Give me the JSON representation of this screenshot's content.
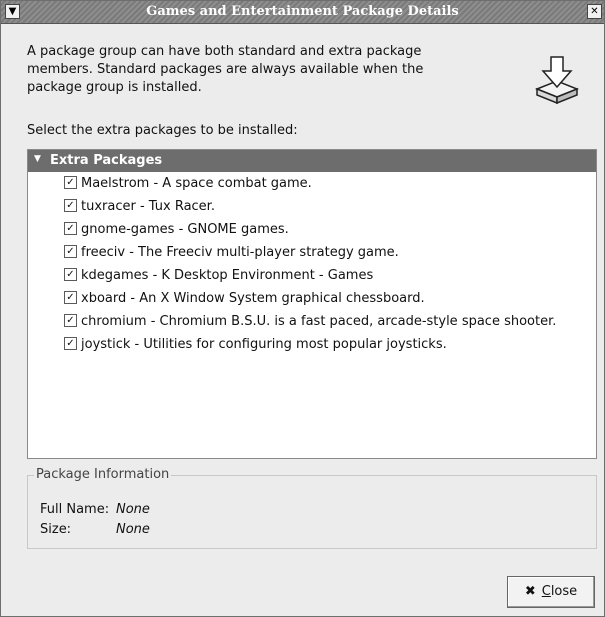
{
  "window": {
    "title": "Games and Entertainment Package Details",
    "menu_icon": "chevron-down-icon",
    "close_icon": "close-icon"
  },
  "description": "A package group can have both standard and extra package members.  Standard packages are always available when the package group is installed.",
  "install_icon": "install-arrow-icon",
  "select_label": "Select the extra packages to be installed:",
  "group": {
    "label": "Extra Packages",
    "expanded": true,
    "items": [
      {
        "label": "Maelstrom - A space combat game.",
        "checked": true
      },
      {
        "label": "tuxracer - Tux Racer.",
        "checked": true
      },
      {
        "label": "gnome-games - GNOME games.",
        "checked": true
      },
      {
        "label": "freeciv - The Freeciv multi-player strategy game.",
        "checked": true
      },
      {
        "label": "kdegames - K Desktop Environment - Games",
        "checked": true
      },
      {
        "label": "xboard - An X Window System graphical chessboard.",
        "checked": true
      },
      {
        "label": "chromium - Chromium B.S.U. is a fast paced, arcade-style space shooter.",
        "checked": true
      },
      {
        "label": "joystick - Utilities for configuring most popular joysticks.",
        "checked": true
      }
    ]
  },
  "package_info": {
    "legend": "Package Information",
    "full_name_label": "Full Name:",
    "full_name_value": "None",
    "size_label": "Size:",
    "size_value": "None"
  },
  "close_button": {
    "icon": "close-x-icon",
    "mnemonic": "C",
    "label_rest": "lose"
  },
  "colors": {
    "header_bg": "#6d6d6d",
    "dialog_bg": "#ececec"
  }
}
